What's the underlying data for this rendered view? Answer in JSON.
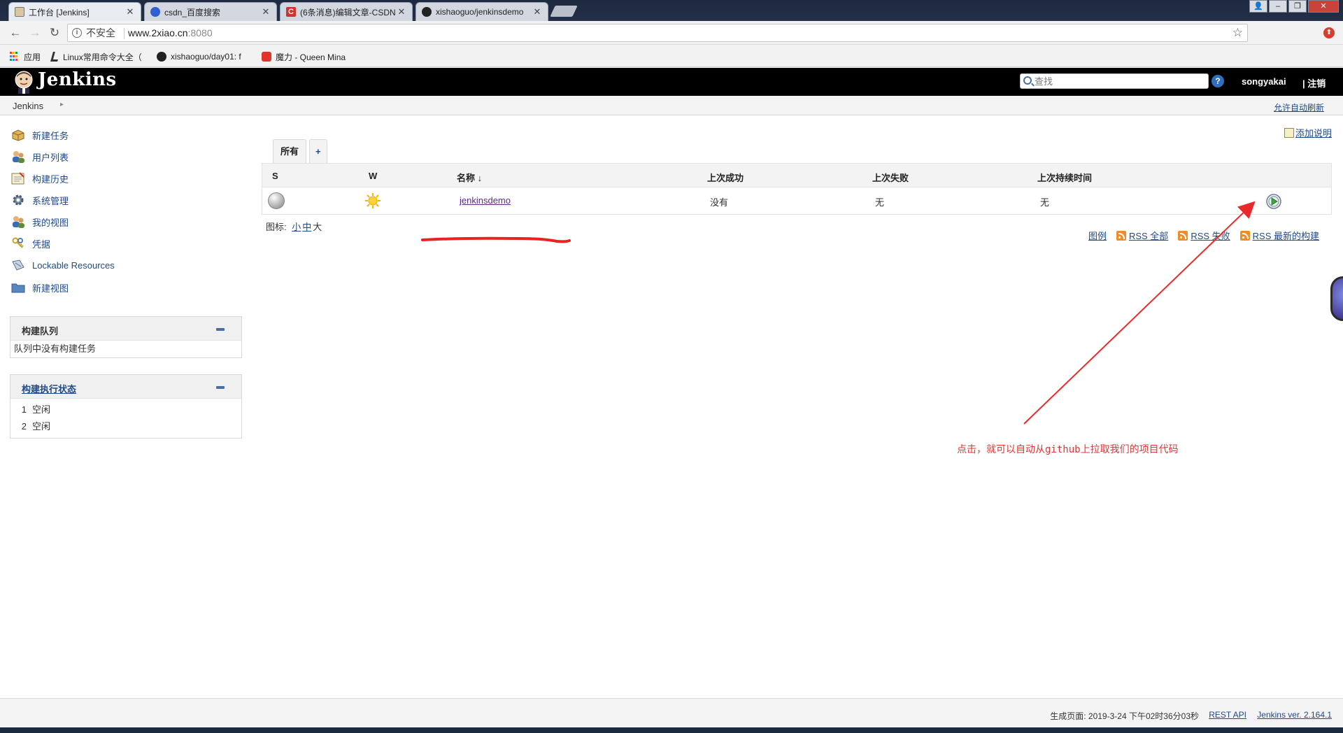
{
  "browser": {
    "tabs": [
      {
        "title": "工作台 [Jenkins]",
        "active": true
      },
      {
        "title": "csdn_百度搜索",
        "active": false
      },
      {
        "title": "(6条消息)编辑文章-CSDN",
        "active": false
      },
      {
        "title": "xishaoguo/jenkinsdemo",
        "active": false
      }
    ],
    "security_label": "不安全",
    "url_host": "www.2xiao.cn",
    "url_port": ":8080",
    "bookmarks": [
      {
        "label": "应用"
      },
      {
        "label": "Linux常用命令大全（"
      },
      {
        "label": "xishaoguo/day01: f"
      },
      {
        "label": "魔力 - Queen Mina"
      }
    ]
  },
  "jenkins": {
    "logo_text": "Jenkins",
    "search_placeholder": "查找",
    "help_label": "?",
    "username": "songyakai",
    "logout_label": "| 注销",
    "breadcrumb": "Jenkins",
    "auto_refresh": "允许自动刷新",
    "sidebar_tasks": [
      {
        "label": "新建任务",
        "icon": "new-package-icon"
      },
      {
        "label": "用户列表",
        "icon": "users-icon"
      },
      {
        "label": "构建历史",
        "icon": "notepad-icon"
      },
      {
        "label": "系统管理",
        "icon": "gear-icon"
      },
      {
        "label": "我的视图",
        "icon": "user-icon"
      },
      {
        "label": "凭据",
        "icon": "keys-icon"
      },
      {
        "label": "Lockable Resources",
        "icon": "lock-icon"
      },
      {
        "label": "新建视图",
        "icon": "folder-icon"
      }
    ],
    "build_queue": {
      "title": "构建队列",
      "empty_text": "队列中没有构建任务"
    },
    "executors": {
      "title": "构建执行状态",
      "items": [
        {
          "num": "1",
          "status": "空闲"
        },
        {
          "num": "2",
          "status": "空闲"
        }
      ]
    },
    "add_description": "添加说明",
    "view_tabs": [
      {
        "label": "所有"
      },
      {
        "label": "+"
      }
    ],
    "table": {
      "headers": {
        "s": "S",
        "w": "W",
        "name": "名称",
        "sort_arrow": "↓",
        "last_success": "上次成功",
        "last_failure": "上次失败",
        "last_duration": "上次持续时间"
      },
      "rows": [
        {
          "name": "jenkinsdemo",
          "last_success": "没有",
          "last_failure": "无",
          "last_duration": "无"
        }
      ]
    },
    "icon_size": {
      "label": "图标:",
      "sizes": [
        "小",
        "中",
        "大"
      ]
    },
    "rss": {
      "legend": "图例",
      "all": "RSS 全部",
      "failed": "RSS 失败",
      "latest": "RSS 最新的构建"
    },
    "footer": {
      "generated": "生成页面: 2019-3-24 下午02时36分03秒",
      "rest_api": "REST API",
      "version": "Jenkins ver. 2.164.1"
    }
  },
  "annotation": {
    "text": "点击，就可以自动从github上拉取我们的项目代码",
    "color": "#e53333"
  }
}
